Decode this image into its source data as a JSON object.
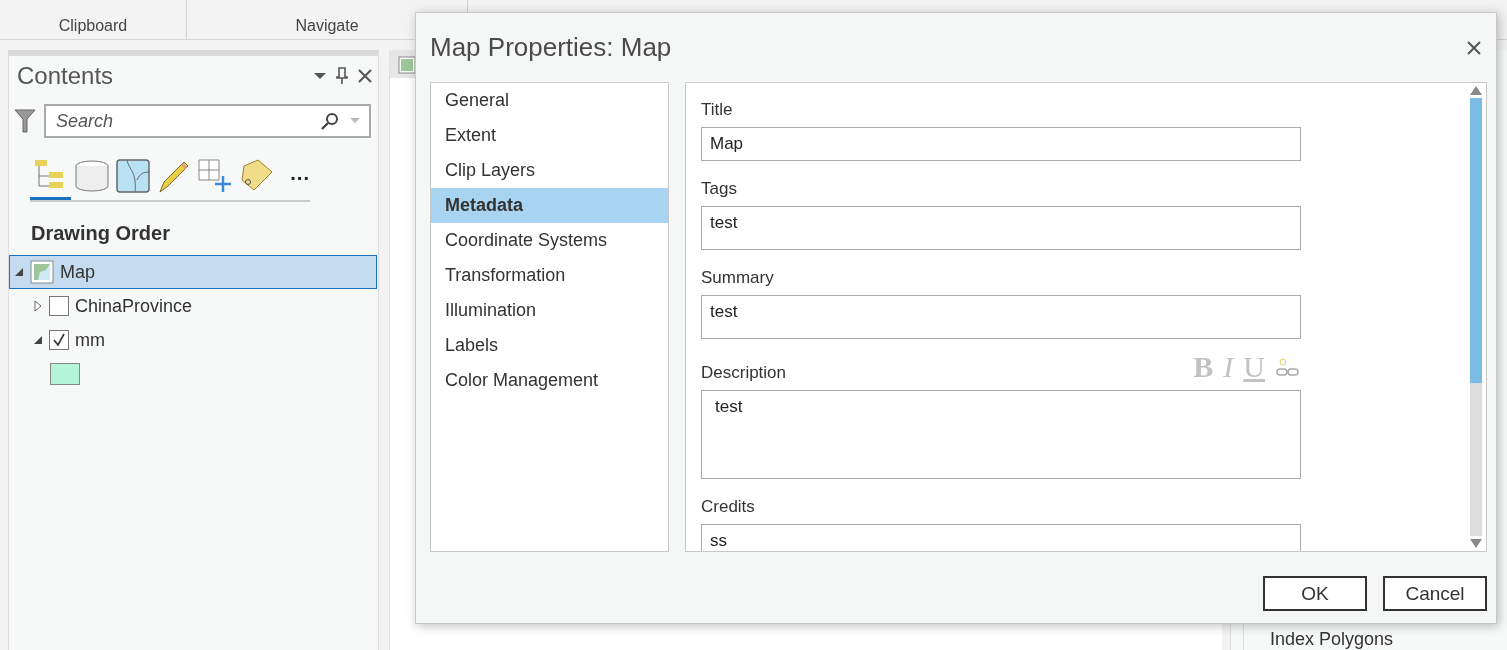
{
  "ribbon": {
    "groups": [
      {
        "label": "Clipboard"
      },
      {
        "label": "Navigate"
      }
    ]
  },
  "contents": {
    "title": "Contents",
    "search": {
      "placeholder": "Search"
    },
    "view_tabs": [
      {
        "selected": true
      },
      {
        "selected": false
      },
      {
        "selected": false
      },
      {
        "selected": false
      },
      {
        "selected": false
      },
      {
        "selected": false
      }
    ],
    "more": "...",
    "heading": "Drawing Order",
    "layers": [
      {
        "name": "Map",
        "kind": "map",
        "selected": true,
        "expanded": true,
        "children": [
          {
            "name": "ChinaProvince",
            "kind": "layer",
            "selected": false,
            "checked": false,
            "expanded": false
          },
          {
            "name": "mm",
            "kind": "layer",
            "selected": false,
            "checked": true,
            "expanded": true,
            "color": "#b3f5d6"
          }
        ]
      }
    ]
  },
  "side_pane": {
    "items": [
      "Index Polygons"
    ]
  },
  "dialog": {
    "title": "Map Properties: Map",
    "nav": [
      {
        "label": "General",
        "selected": false
      },
      {
        "label": "Extent",
        "selected": false
      },
      {
        "label": "Clip Layers",
        "selected": false
      },
      {
        "label": "Metadata",
        "selected": true
      },
      {
        "label": "Coordinate Systems",
        "selected": false
      },
      {
        "label": "Transformation",
        "selected": false
      },
      {
        "label": "Illumination",
        "selected": false
      },
      {
        "label": "Labels",
        "selected": false
      },
      {
        "label": "Color Management",
        "selected": false
      }
    ],
    "fields": [
      {
        "label": "Title",
        "value": "Map",
        "kind": "line"
      },
      {
        "label": "Tags",
        "value": "test",
        "kind": "box"
      },
      {
        "label": "Summary",
        "value": "test",
        "kind": "box"
      },
      {
        "label": "Description",
        "value": "test",
        "kind": "rich",
        "toolbar": [
          "B",
          "I",
          "U"
        ]
      },
      {
        "label": "Credits",
        "value": "ss",
        "kind": "box"
      }
    ],
    "buttons": [
      "OK",
      "Cancel"
    ]
  }
}
